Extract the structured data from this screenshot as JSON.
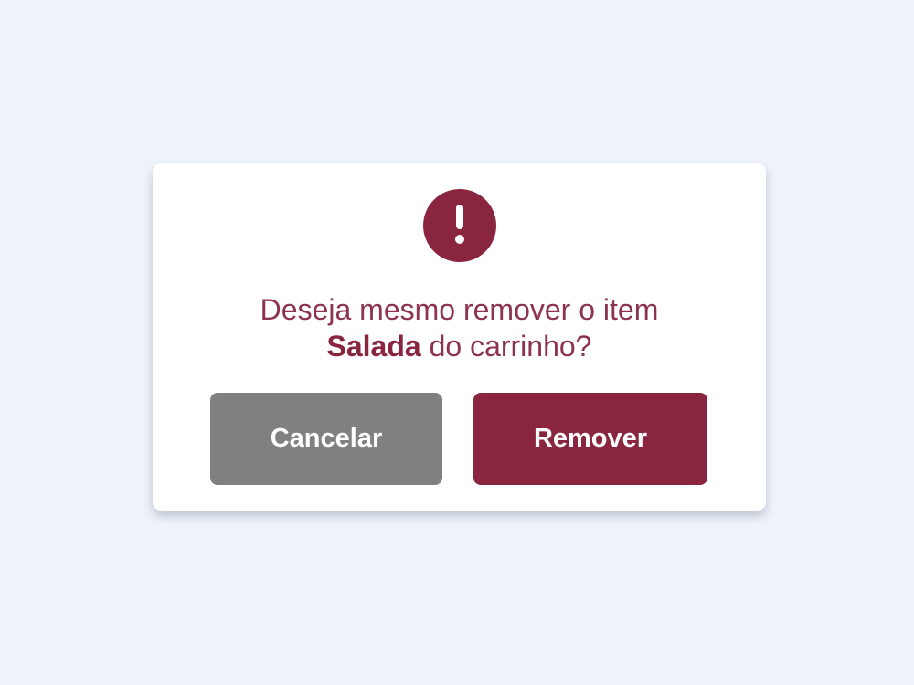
{
  "dialog": {
    "icon": "exclamation-icon",
    "message_line1": "Deseja mesmo remover o item",
    "item_name": "Salada",
    "message_line2_suffix": " do carrinho?",
    "cancel_label": "Cancelar",
    "remove_label": "Remover"
  },
  "colors": {
    "page_background": "#eef2fa",
    "accent": "#8a2540",
    "message_text": "#8d3352",
    "cancel_button": "#808080"
  }
}
